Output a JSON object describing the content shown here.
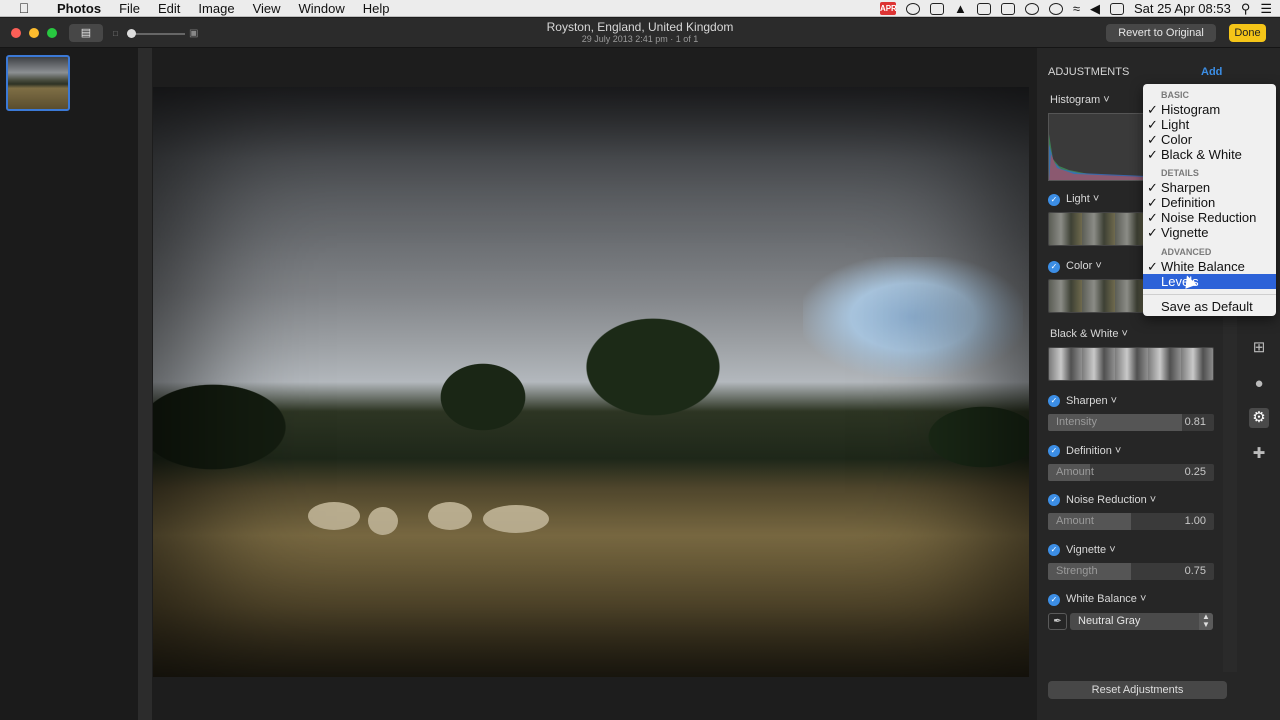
{
  "menubar": {
    "app": "Photos",
    "menus": [
      "File",
      "Edit",
      "Image",
      "View",
      "Window",
      "Help"
    ],
    "calendar_day": "APR 25",
    "datetime": "Sat 25 Apr  08:53"
  },
  "window": {
    "title": "Royston, England, United Kingdom",
    "subtitle": "29 July 2013 2:41 pm  ·  1 of 1",
    "revert_label": "Revert to Original",
    "done_label": "Done"
  },
  "adjustments": {
    "header": "ADJUSTMENTS",
    "add_label": "Add",
    "histogram_label": "Histogram",
    "light_label": "Light",
    "color_label": "Color",
    "bw_label": "Black & White",
    "sharpen": {
      "label": "Sharpen",
      "slider_label": "Intensity",
      "value": "0.81",
      "level": 0.81
    },
    "definition": {
      "label": "Definition",
      "slider_label": "Amount",
      "value": "0.25",
      "level": 0.25
    },
    "noise": {
      "label": "Noise Reduction",
      "slider_label": "Amount",
      "value": "1.00",
      "level": 0.5
    },
    "vignette": {
      "label": "Vignette",
      "slider_label": "Strength",
      "value": "0.75",
      "level": 0.5
    },
    "wb": {
      "label": "White Balance",
      "mode": "Neutral Gray"
    },
    "reset_label": "Reset Adjustments"
  },
  "dropdown": {
    "basic_title": "BASIC",
    "basic": [
      "Histogram",
      "Light",
      "Color",
      "Black & White"
    ],
    "details_title": "DETAILS",
    "details": [
      "Sharpen",
      "Definition",
      "Noise Reduction",
      "Vignette"
    ],
    "advanced_title": "ADVANCED",
    "advanced_checked": "White Balance",
    "advanced_highlighted": "Levels",
    "save_default": "Save as Default"
  },
  "colors": {
    "accent": "#2c62d8",
    "done": "#f5c518",
    "check": "#3c8ee5"
  }
}
